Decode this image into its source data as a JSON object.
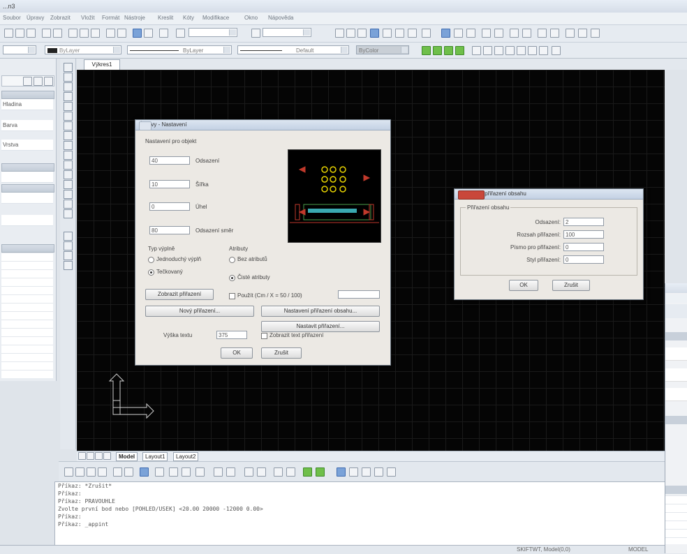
{
  "window": {
    "title": "...n3"
  },
  "menubar": {
    "items": [
      "Soubor",
      "Úpravy",
      "Zobrazit",
      "Vložit",
      "Formát",
      "Nástroje",
      "Kreslit",
      "Kóty",
      "Modifikace",
      "Okno",
      "Nápověda"
    ]
  },
  "toolbar2": {
    "layer_combo": "ByLayer",
    "linetype_combo": "ByLayer",
    "lineweight_combo": "Default",
    "color_combo": "ByColor"
  },
  "drawing_tab": "Výkres1",
  "layout_tabs": [
    "Model",
    "Layout1",
    "Layout2"
  ],
  "left_panel_rows": [
    "Hladina",
    "Barva",
    "Vrstva"
  ],
  "dialog_main": {
    "title": "Úpravy - Nastavení",
    "group_label": "Nastavení pro objekt",
    "fields": [
      {
        "value": "40",
        "label": "Odsazení"
      },
      {
        "value": "10",
        "label": "Šířka"
      },
      {
        "value": "0",
        "label": "Úhel"
      },
      {
        "value": "80",
        "label": "Odsazení směr"
      }
    ],
    "type_label": "Typ výplně",
    "type_options": [
      "Jednoduchý výplň",
      "Tečkovaný"
    ],
    "attr_label": "Atributy",
    "attr_options": [
      "Bez atributů",
      "Čisté atributy"
    ],
    "assign_button": "Zobrazit přiřazení",
    "check_label": "Použít (Cm / X = 50 / 100)",
    "btn_mirror": "Nový přiřazení...",
    "btn_settings": "Nastavení přiřazení obsahu...",
    "btn_font": "Nastavit přiřazení...",
    "height_label": "Výška textu",
    "height_value": "375",
    "checkbox_label": "Zobrazit text přiřazení",
    "ok": "OK",
    "cancel": "Zrušit"
  },
  "dialog_small": {
    "title": "Nastavení přiřazení obsahu",
    "group_label": "Přiřazení obsahu",
    "rows": [
      {
        "label": "Odsazení:",
        "value": "2"
      },
      {
        "label": "Rozsah přiřazení:",
        "value": "100"
      },
      {
        "label": "Písmo pro přiřazení:",
        "value": "0"
      },
      {
        "label": "Styl přiřazení:",
        "value": "0"
      }
    ],
    "ok": "OK",
    "cancel": "Zrušit"
  },
  "command_lines": [
    "Příkaz: *Zrušit*",
    "Příkaz:",
    "Příkaz: PRAVOUHLE",
    "Zvolte první bod nebo [POHLED/USEK] <20.00 20000 -12000 0.00>",
    "Příkaz:",
    "Příkaz: _appint"
  ],
  "status": {
    "left": "",
    "right1": "SKIFTWT, Model(0,0)",
    "right2": "MODEL"
  },
  "colors": {
    "canvas": "#050505",
    "grid": "#1a1a1a",
    "dialog": "#ece9e4",
    "accent_red": "#c0392b",
    "ucs": "#cccccc"
  }
}
